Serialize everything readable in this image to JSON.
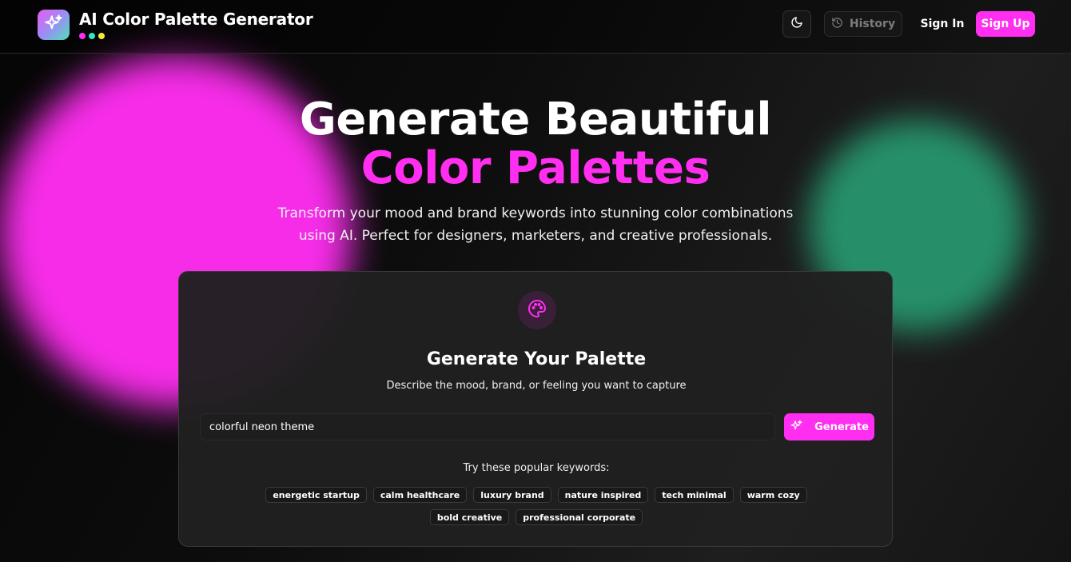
{
  "app": {
    "title": "AI Color Palette Generator",
    "dot_colors": [
      "#ff2ef0",
      "#2ee6c8",
      "#f5ea3a"
    ]
  },
  "nav": {
    "theme_icon": "moon-icon",
    "history_label": "History",
    "history_icon": "history-icon",
    "sign_in_label": "Sign In",
    "sign_up_label": "Sign Up"
  },
  "hero": {
    "line1": "Generate Beautiful",
    "line2": "Color Palettes",
    "subtitle": "Transform your mood and brand keywords into stunning color combinations using AI. Perfect for designers, marketers, and creative professionals."
  },
  "card": {
    "icon": "palette-icon",
    "title": "Generate Your Palette",
    "subtitle": "Describe the mood, brand, or feeling you want to capture",
    "input_value": "colorful neon theme",
    "generate_label": "Generate",
    "keywords_label": "Try these popular keywords:",
    "keywords": [
      "energetic startup",
      "calm healthcare",
      "luxury brand",
      "nature inspired",
      "tech minimal",
      "warm cozy",
      "bold creative",
      "professional corporate"
    ]
  },
  "colors": {
    "accent": "#ff2ef0",
    "accent_green": "#279c72",
    "background": "#0a0a0a",
    "card": "#202020"
  }
}
